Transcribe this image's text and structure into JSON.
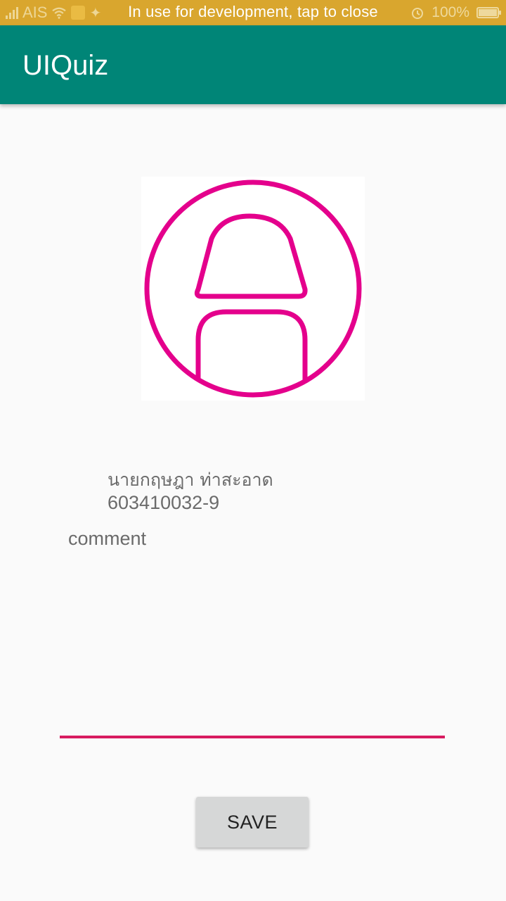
{
  "status_bar": {
    "carrier": "AIS",
    "message": "In use for development, tap to close",
    "battery_percent": "100%",
    "bg_color": "#d9a62e"
  },
  "app_bar": {
    "title": "UIQuiz",
    "bg_color": "#008577"
  },
  "profile": {
    "avatar_icon": "person-avatar-icon",
    "avatar_color": "#e4008c",
    "name": "นายกฤษฎา ท่าสะอาด",
    "student_id": "603410032-9"
  },
  "comment": {
    "placeholder": "comment",
    "value": "",
    "underline_color": "#d81b60"
  },
  "actions": {
    "save_label": "SAVE"
  }
}
